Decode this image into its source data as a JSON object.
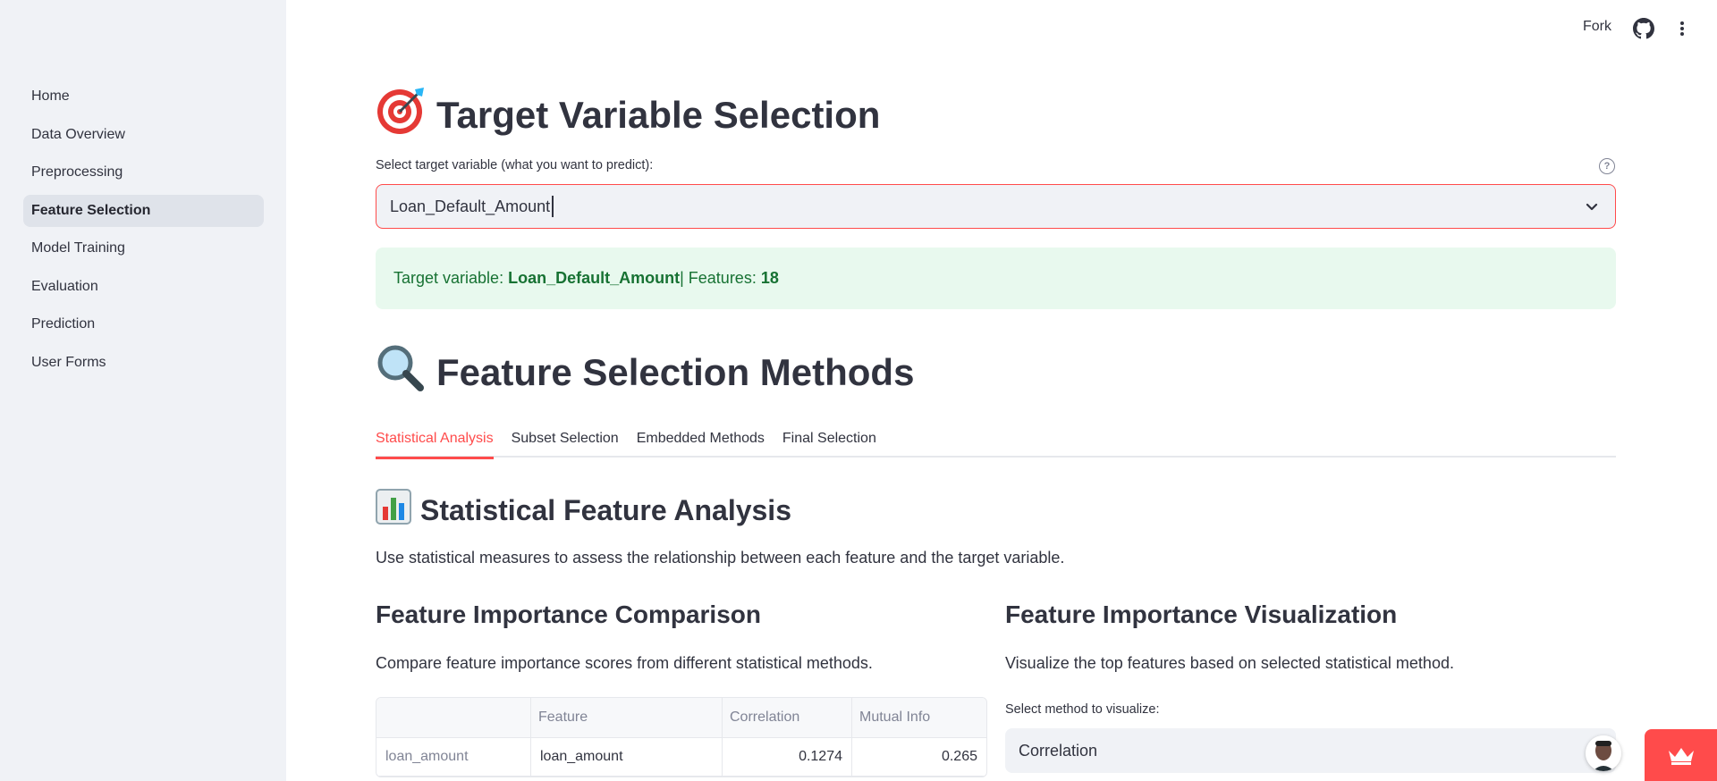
{
  "sidebar": {
    "items": [
      {
        "label": "Home"
      },
      {
        "label": "Data Overview"
      },
      {
        "label": "Preprocessing"
      },
      {
        "label": "Feature Selection",
        "active": true
      },
      {
        "label": "Model Training"
      },
      {
        "label": "Evaluation"
      },
      {
        "label": "Prediction"
      },
      {
        "label": "User Forms"
      }
    ]
  },
  "header": {
    "fork_label": "Fork",
    "github_icon": "github-icon",
    "menu_icon": "kebab-menu-icon"
  },
  "target_section": {
    "emoji_icon": "direct-hit-icon",
    "title": "Target Variable Selection",
    "select_label": "Select target variable (what you want to predict):",
    "select_value": "Loan_Default_Amount",
    "help_icon": "question-circle-icon",
    "success_prefix": "Target variable: ",
    "success_target": "Loan_Default_Amount",
    "success_sep": " | Features: ",
    "success_count": "18"
  },
  "methods_section": {
    "emoji_icon": "magnifying-glass-icon",
    "title": "Feature Selection Methods",
    "tabs": [
      {
        "label": "Statistical Analysis",
        "active": true
      },
      {
        "label": "Subset Selection"
      },
      {
        "label": "Embedded Methods"
      },
      {
        "label": "Final Selection"
      }
    ]
  },
  "statistical": {
    "emoji_icon": "bar-chart-icon",
    "title": "Statistical Feature Analysis",
    "description": "Use statistical measures to assess the relationship between each feature and the target variable."
  },
  "comparison": {
    "title": "Feature Importance Comparison",
    "description": "Compare feature importance scores from different statistical methods.",
    "columns": [
      "",
      "Feature",
      "Correlation",
      "Mutual Info"
    ],
    "rows": [
      {
        "index": "loan_amount",
        "feature": "loan_amount",
        "correlation": "0.1274",
        "mutual_info": "0.265"
      }
    ]
  },
  "visualization": {
    "title": "Feature Importance Visualization",
    "description": "Visualize the top features based on selected statistical method.",
    "select_label": "Select method to visualize:",
    "select_value": "Correlation"
  },
  "colors": {
    "accent": "#ff4b4b",
    "success_bg": "#e8f9ee",
    "success_text": "#177233",
    "sidebar_bg": "#f0f2f6"
  }
}
